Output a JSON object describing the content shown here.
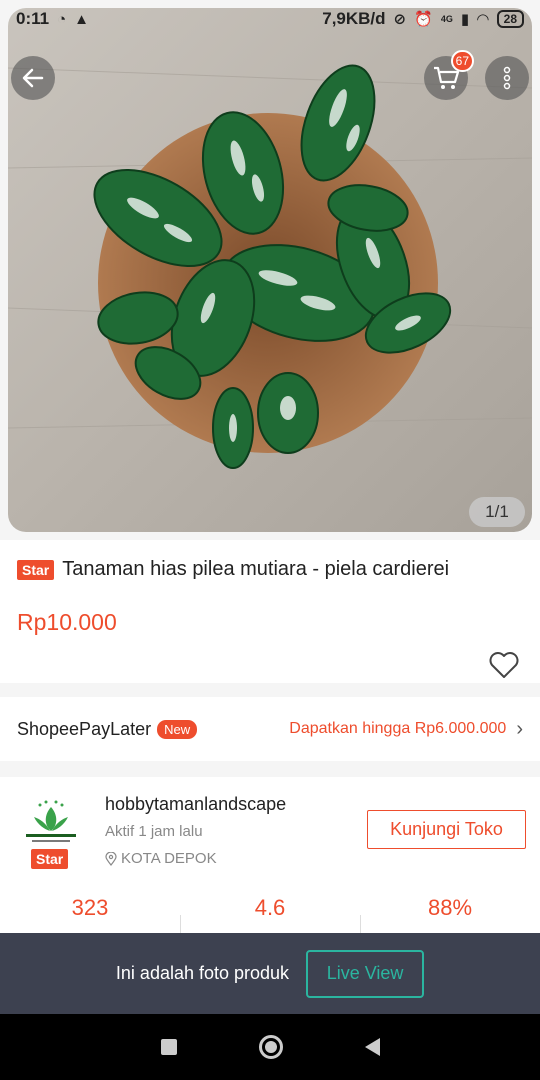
{
  "status_bar": {
    "time": "0:11",
    "network_speed": "7,9KB/d",
    "signal_label": "4G",
    "battery": "28"
  },
  "product": {
    "image_counter": "1/1",
    "cart_count": "67",
    "star_badge": "Star",
    "title": "Tanaman hias pilea mutiara - piela cardierei",
    "price": "Rp10.000"
  },
  "paylater": {
    "label": "ShopeePayLater",
    "new_badge": "New",
    "offer": "Dapatkan hingga Rp6.000.000"
  },
  "shop": {
    "name": "hobbytamanlandscape",
    "active": "Aktif 1 jam lalu",
    "location": "KOTA DEPOK",
    "star_badge": "Star",
    "visit_label": "Kunjungi Toko",
    "stats": [
      "323",
      "4.6",
      "88%"
    ]
  },
  "banner": {
    "text": "Ini adalah foto produk",
    "live_label": "Live View"
  },
  "colors": {
    "accent": "#ee4d2d",
    "banner_bg": "#3d4150",
    "live_teal": "#2bb5a0"
  },
  "icons": [
    "back-arrow-icon",
    "cart-icon",
    "more-vertical-icon",
    "heart-icon",
    "chevron-right-icon",
    "location-pin-icon",
    "nav-recents-icon",
    "nav-home-icon",
    "nav-back-icon"
  ]
}
